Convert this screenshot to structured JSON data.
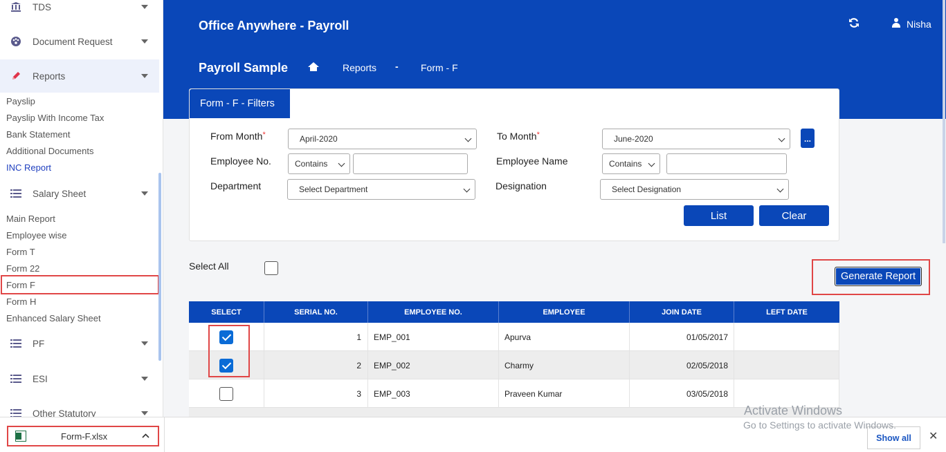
{
  "app": {
    "title": "Office Anywhere - Payroll",
    "user": "Nisha"
  },
  "breadcrumb": {
    "company": "Payroll Sample",
    "section": "Reports",
    "separator": "-",
    "page": "Form - F"
  },
  "sidebar": {
    "menus": [
      {
        "label": "TDS",
        "icon": "bank-icon"
      },
      {
        "label": "Document Request",
        "icon": "dashboard-icon"
      },
      {
        "label": "Reports",
        "icon": "pencil-icon"
      },
      {
        "label": "Salary Sheet",
        "icon": "list-icon"
      },
      {
        "label": "PF",
        "icon": "list-icon"
      },
      {
        "label": "ESI",
        "icon": "list-icon"
      },
      {
        "label": "Other Statutory",
        "icon": "list-icon"
      }
    ],
    "reports_items": [
      "Payslip",
      "Payslip With Income Tax",
      "Bank Statement",
      "Additional Documents",
      "INC Report"
    ],
    "salary_items": [
      "Main Report",
      "Employee wise",
      "Form T",
      "Form 22",
      "Form F",
      "Form H",
      "Enhanced Salary Sheet"
    ]
  },
  "filters": {
    "tab_label": "Form - F - Filters",
    "from_month_label": "From Month",
    "from_month_value": "April-2020",
    "to_month_label": "To Month",
    "to_month_value": "June-2020",
    "required_mark": "*",
    "more_label": "...",
    "employee_no_label": "Employee No.",
    "employee_no_op": "Contains",
    "employee_name_label": "Employee Name",
    "employee_name_op": "Contains",
    "department_label": "Department",
    "department_value": "Select Department",
    "designation_label": "Designation",
    "designation_value": "Select Designation",
    "list_button": "List",
    "clear_button": "Clear"
  },
  "select_all_label": "Select All",
  "generate_button": "Generate Report",
  "table": {
    "headers": [
      "SELECT",
      "SERIAL NO.",
      "EMPLOYEE NO.",
      "EMPLOYEE",
      "JOIN DATE",
      "LEFT DATE"
    ],
    "rows": [
      {
        "checked": true,
        "serial": "1",
        "emp_no": "EMP_001",
        "name": "Apurva",
        "join": "01/05/2017",
        "left": ""
      },
      {
        "checked": true,
        "serial": "2",
        "emp_no": "EMP_002",
        "name": "Charmy",
        "join": "02/05/2018",
        "left": ""
      },
      {
        "checked": false,
        "serial": "3",
        "emp_no": "EMP_003",
        "name": "Praveen Kumar",
        "join": "03/05/2018",
        "left": ""
      }
    ]
  },
  "download_bar": {
    "file_name": "Form-F.xlsx",
    "show_all": "Show all",
    "close": "✕"
  },
  "watermark": {
    "line1": "Activate Windows",
    "line2": "Go to Settings to activate Windows."
  },
  "colors": {
    "primary": "#0a47b8",
    "highlight_border": "#e04646",
    "checkbox_on": "#0a6bd6"
  }
}
